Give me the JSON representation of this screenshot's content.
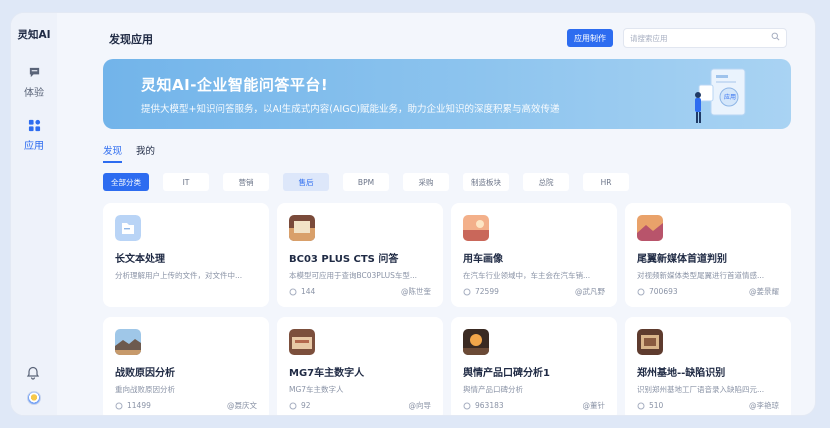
{
  "sidebar": {
    "brand": "灵知AI",
    "items": [
      {
        "label": "体验",
        "icon": "chat-icon"
      },
      {
        "label": "应用",
        "icon": "apps-icon"
      }
    ],
    "bottom": {
      "icon": "bell-icon"
    }
  },
  "header": {
    "title": "发现应用",
    "create_label": "应用制作",
    "search_placeholder": "请搜索应用"
  },
  "banner": {
    "title": "灵知AI-企业智能问答平台!",
    "subtitle": "提供大模型+知识问答服务，以AI生成式内容(AIGC)赋能业务，助力企业知识的深度积累与高效传递",
    "badge": "应用"
  },
  "tabs": [
    "发现",
    "我的"
  ],
  "filters": [
    "全部分类",
    "IT",
    "营销",
    "售后",
    "BPM",
    "采购",
    "制造板块",
    "总院",
    "HR"
  ],
  "cards": [
    {
      "title": "长文本处理",
      "desc": "分析理解用户上传的文件，对文件中...",
      "views": "",
      "author": "",
      "icon": "folder"
    },
    {
      "title": "BC03 PLUS CTS 问答",
      "desc": "本模型可应用于查询BC03PLUS车型...",
      "views": "144",
      "author": "@陈世奎",
      "icon": "photo"
    },
    {
      "title": "用车画像",
      "desc": "在汽车行业领域中，车主会在汽车销...",
      "views": "72599",
      "author": "@武凡野",
      "icon": "photo"
    },
    {
      "title": "尾翼新媒体首道判别",
      "desc": "对视频新媒体类型尾翼进行首道情感...",
      "views": "700693",
      "author": "@姜景耀",
      "icon": "photo"
    },
    {
      "title": "战败原因分析",
      "desc": "重向战败原因分析",
      "views": "11499",
      "author": "@聂庆文",
      "icon": "photo"
    },
    {
      "title": "MG7车主数字人",
      "desc": "MG7车主数字人",
      "views": "92",
      "author": "@向导",
      "icon": "photo"
    },
    {
      "title": "舆情产品口碑分析1",
      "desc": "舆情产品口碑分析",
      "views": "963183",
      "author": "@董针",
      "icon": "photo"
    },
    {
      "title": "郑州基地--缺陷识别",
      "desc": "识别郑州基地工厂语音录入缺陷四元...",
      "views": "510",
      "author": "@李艳琼",
      "icon": "photo"
    }
  ],
  "colors": {
    "accent": "#2d6cf0",
    "banner_start": "#72b4ea",
    "banner_end": "#a9d3f3"
  }
}
